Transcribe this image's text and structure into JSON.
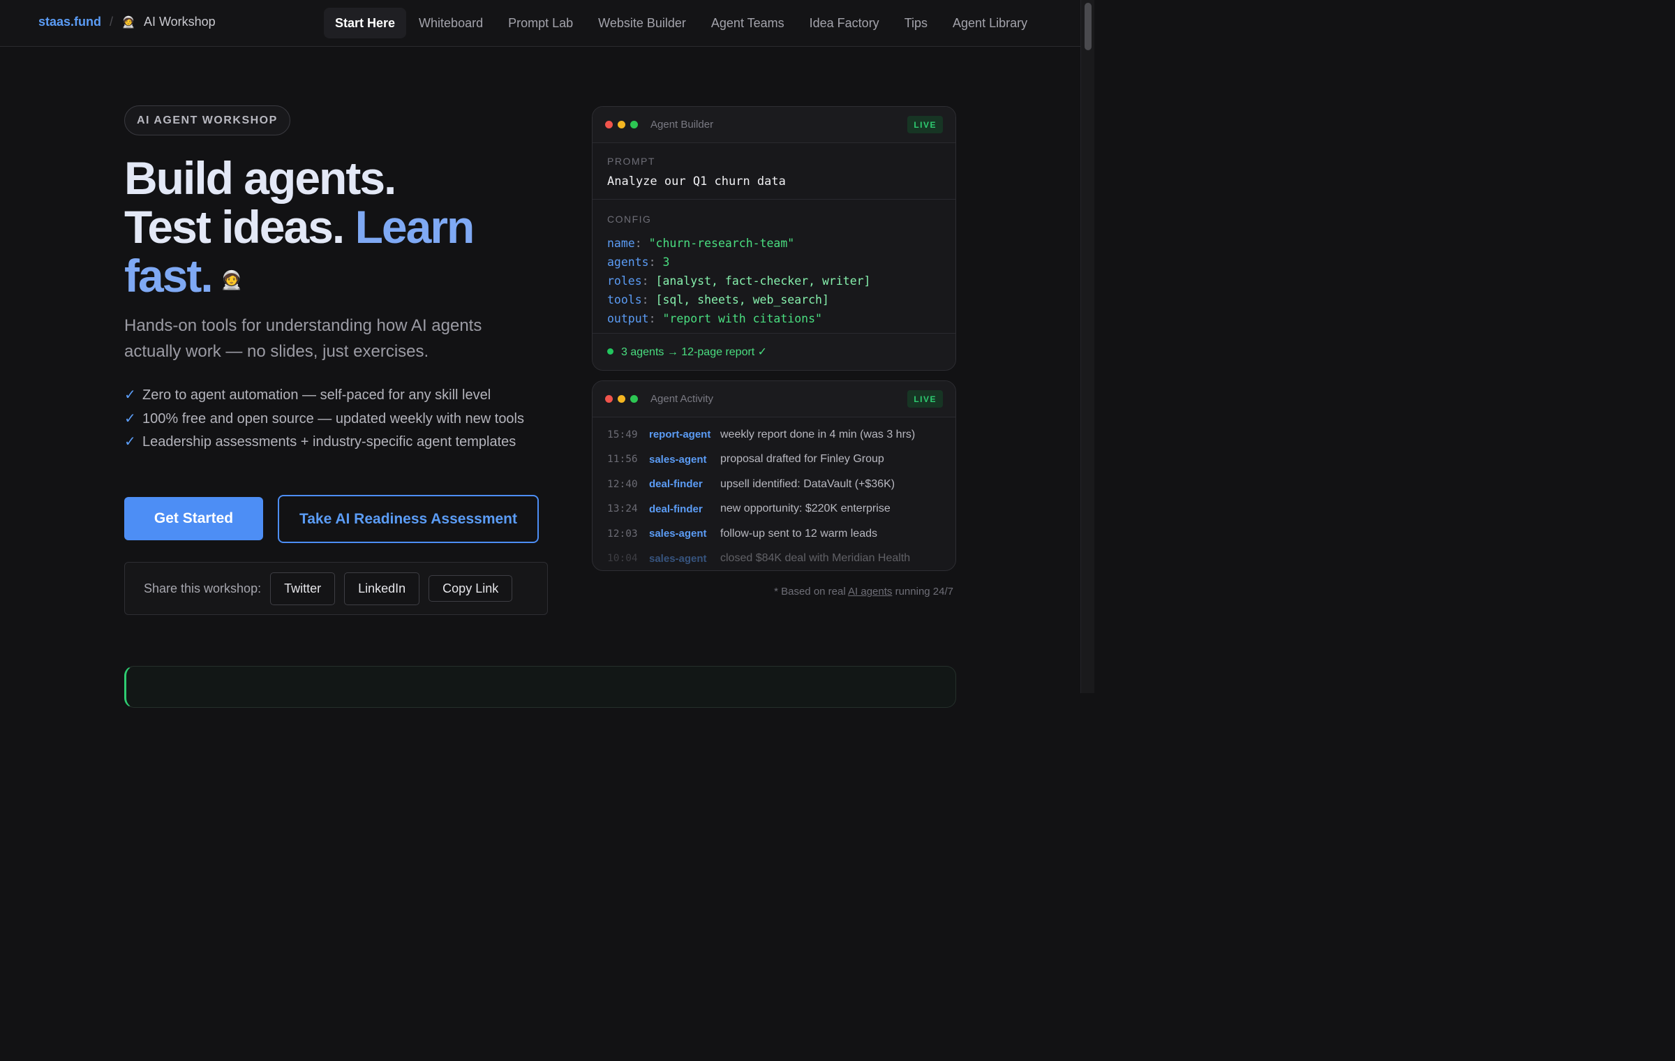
{
  "header": {
    "site": "staas.fund",
    "separator": "/",
    "section_icon": "🧑‍🚀",
    "section": "AI Workshop",
    "nav": [
      {
        "label": "Start Here"
      },
      {
        "label": "Whiteboard"
      },
      {
        "label": "Prompt Lab"
      },
      {
        "label": "Website Builder"
      },
      {
        "label": "Agent Teams"
      },
      {
        "label": "Idea Factory"
      },
      {
        "label": "Tips"
      },
      {
        "label": "Agent Library"
      }
    ]
  },
  "hero": {
    "pill": "AI AGENT WORKSHOP",
    "headline_line1": "Build agents.",
    "headline_line2a": "Test ideas. ",
    "headline_line2b": "Learn",
    "headline_line3": "fast.",
    "headline_emoji": "🧑‍🚀",
    "subtitle": "Hands-on tools for understanding how AI agents actually work — no slides, just exercises.",
    "checks": [
      "Zero to agent automation — self-paced for any skill level",
      "100% free and open source — updated weekly with new tools",
      "Leadership assessments + industry-specific agent templates"
    ],
    "check_mark": "✓",
    "primary_button": "Get Started",
    "secondary_button": "Take AI Readiness Assessment"
  },
  "share": {
    "label": "Share this workshop:",
    "buttons": [
      "Twitter",
      "LinkedIn",
      "Copy Link"
    ]
  },
  "builder_card": {
    "title": "Agent Builder",
    "live": "LIVE",
    "prompt_label": "PROMPT",
    "prompt": "Analyze our Q1 churn data",
    "config_label": "CONFIG",
    "config": [
      {
        "key": "name",
        "value": "\"churn-research-team\""
      },
      {
        "key": "agents",
        "value": "3"
      },
      {
        "key": "roles",
        "value": "[analyst, fact-checker, writer]"
      },
      {
        "key": "tools",
        "value": "[sql, sheets, web_search]"
      },
      {
        "key": "output",
        "value": "\"report with citations\""
      }
    ],
    "status": "3 agents → 12-page report ✓"
  },
  "activity_card": {
    "title": "Agent Activity",
    "live": "LIVE",
    "rows": [
      {
        "time": "15:49",
        "agent": "report-agent",
        "msg": "weekly report done in 4 min (was 3 hrs)"
      },
      {
        "time": "11:56",
        "agent": "sales-agent",
        "msg": "proposal drafted for Finley Group"
      },
      {
        "time": "12:40",
        "agent": "deal-finder",
        "msg": "upsell identified: DataVault (+$36K)"
      },
      {
        "time": "13:24",
        "agent": "deal-finder",
        "msg": "new opportunity: $220K enterprise"
      },
      {
        "time": "12:03",
        "agent": "sales-agent",
        "msg": "follow-up sent to 12 warm leads"
      },
      {
        "time": "10:04",
        "agent": "sales-agent",
        "msg": "closed $84K deal with Meridian Health"
      }
    ]
  },
  "footnote": {
    "prefix": "* Based on real ",
    "link": "AI agents",
    "suffix": " running 24/7"
  },
  "colors": {
    "accent": "#5b9cf5",
    "live_green": "#2ecc71",
    "background": "#121214"
  }
}
